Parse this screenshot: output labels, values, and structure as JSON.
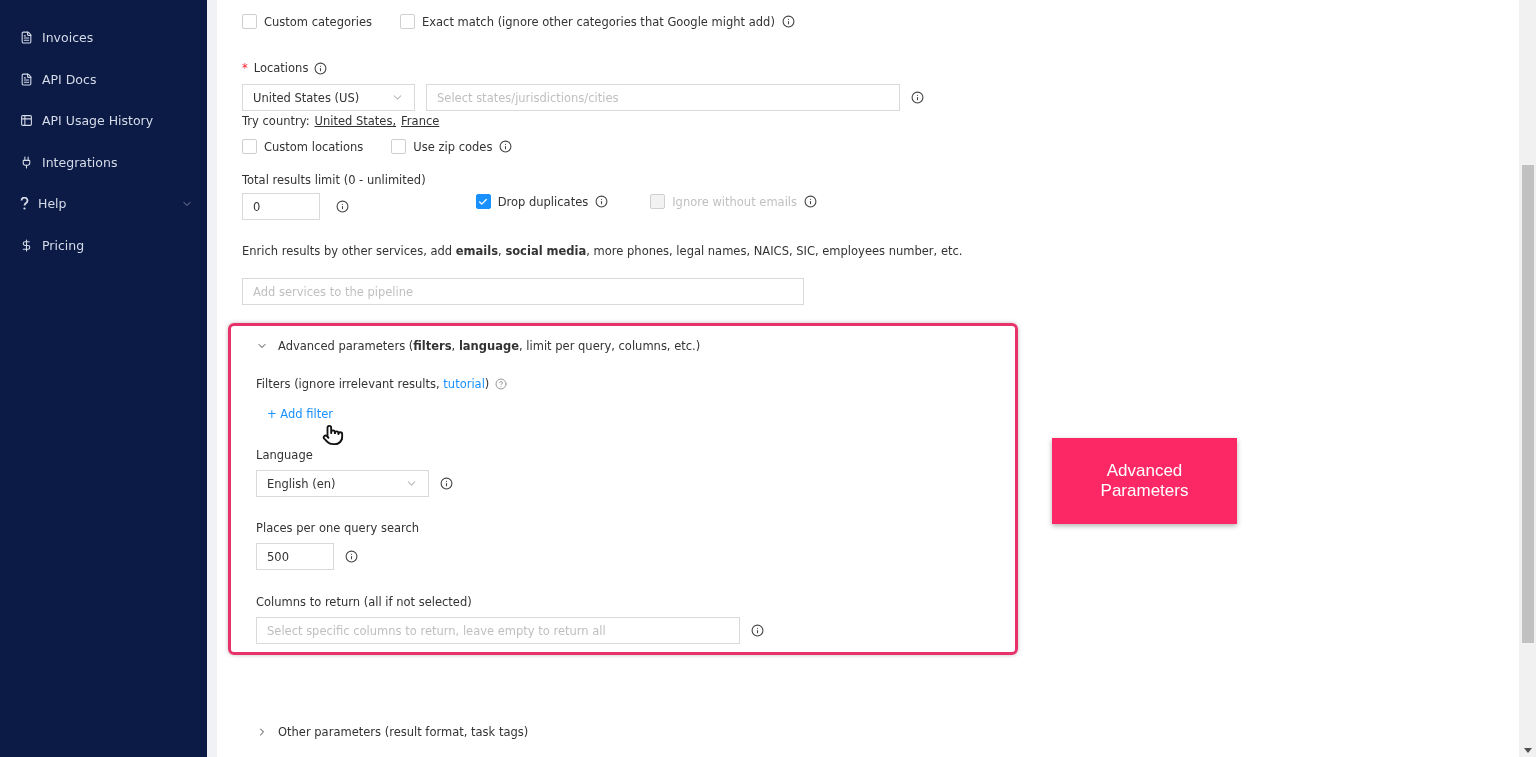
{
  "sidebar": {
    "items": [
      {
        "label": "Invoices",
        "expandable": false
      },
      {
        "label": "API Docs",
        "expandable": false
      },
      {
        "label": "API Usage History",
        "expandable": false
      },
      {
        "label": "Integrations",
        "expandable": false
      },
      {
        "label": "Help",
        "expandable": true
      },
      {
        "label": "Pricing",
        "expandable": false
      }
    ]
  },
  "category_options": [
    {
      "label": "Custom categories",
      "checked": false,
      "disabled": false,
      "info": false
    },
    {
      "label": "Exact match (ignore other categories that Google might add)",
      "checked": false,
      "disabled": false,
      "info": true
    }
  ],
  "locations": {
    "label": "Locations",
    "required_mark": "*",
    "country": "United States (US)",
    "cities_placeholder": "Select states/jurisdictions/cities",
    "try_label": "Try country:",
    "try_links": [
      "United States,",
      "France"
    ],
    "options": [
      {
        "label": "Custom locations",
        "checked": false,
        "disabled": false,
        "info": false
      },
      {
        "label": "Use zip codes",
        "checked": false,
        "disabled": false,
        "info": true
      }
    ]
  },
  "limit": {
    "label": "Total results limit (0 - unlimited)",
    "value": "0",
    "options": [
      {
        "label": "Drop duplicates",
        "checked": true,
        "disabled": false,
        "info": true
      },
      {
        "label": "Ignore without emails",
        "checked": false,
        "disabled": true,
        "info": true
      }
    ]
  },
  "enrich": {
    "text": "Enrich results by other services, add **emails**, **social media**, more phones, legal names, NAICS, SIC, employees number, etc.",
    "placeholder": "Add services to the pipeline"
  },
  "advanced": {
    "title": "Advanced parameters (**filters**, **language**, limit per query, columns, etc.)",
    "expanded": true,
    "highlighted": true,
    "filters_text": "Filters (ignore irrelevant results, ",
    "filters_link": "tutorial",
    "filters_end": ")",
    "add_filter": "+ Add filter",
    "language_label": "Language",
    "language": "English (en)",
    "places_label": "Places per one query search",
    "places": "500",
    "columns_label": "Columns to return (all if not selected)",
    "columns_placeholder": "Select specific columns to return, leave empty to return all"
  },
  "other": {
    "title": "Other parameters (result format, task tags)",
    "expanded": false
  },
  "callout": {
    "text": "Advanced Parameters"
  }
}
